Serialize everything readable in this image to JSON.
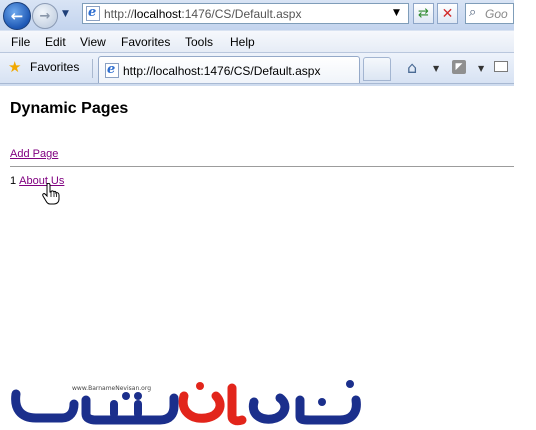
{
  "browser": {
    "address_url_prefix": "http://",
    "address_url_host": "localhost",
    "address_url_rest": ":1476/CS/Default.aspx",
    "search_placeholder": "Goo",
    "menu": [
      "File",
      "Edit",
      "View",
      "Favorites",
      "Tools",
      "Help"
    ],
    "favorites_label": "Favorites",
    "tab_title": "http://localhost:1476/CS/Default.aspx",
    "icons": {
      "back": "back-arrow-icon",
      "forward": "forward-arrow-icon",
      "refresh": "refresh-icon",
      "stop": "stop-icon",
      "search": "search-icon",
      "favorites": "star-icon",
      "home": "home-icon",
      "feeds": "rss-feed-icon",
      "mail": "mail-icon"
    },
    "colors": {
      "chrome": "#cfdcef",
      "visited_link": "#800080"
    }
  },
  "page": {
    "title": "Dynamic Pages",
    "add_link": "Add Page",
    "rows": [
      {
        "id": "1",
        "name": "About Us"
      }
    ]
  },
  "watermark": {
    "url_text": "www.BarnameNevisan.org",
    "colors": {
      "primary": "#1b2f8c",
      "accent": "#e2251b"
    }
  }
}
